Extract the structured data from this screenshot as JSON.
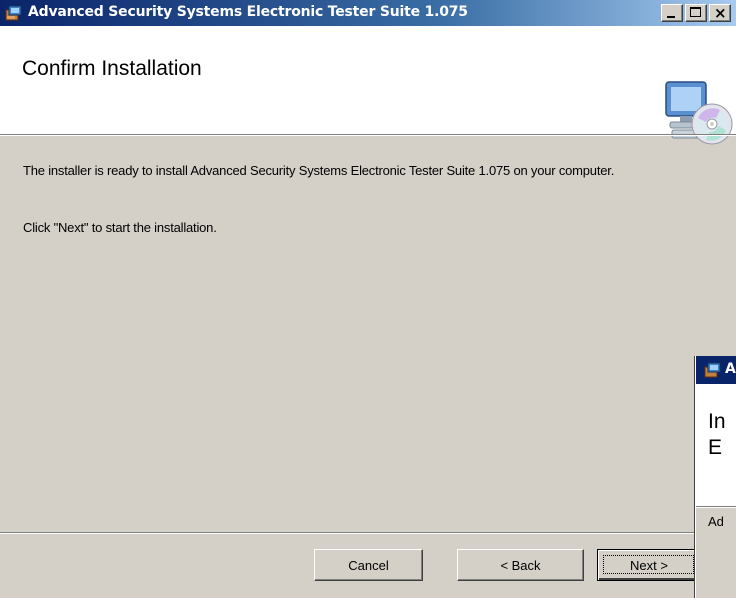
{
  "window": {
    "title": "Advanced Security Systems Electronic Tester Suite 1.075",
    "controls": {
      "minimize_icon": "minimize-icon",
      "maximize_icon": "maximize-icon",
      "close_icon": "close-icon"
    }
  },
  "banner": {
    "title": "Confirm Installation",
    "icon": "computer-cd-icon"
  },
  "body": {
    "line1": "The installer is ready to install Advanced Security Systems Electronic Tester Suite 1.075 on your computer.",
    "line2": "Click \"Next\" to start the installation."
  },
  "buttons": {
    "cancel": "Cancel",
    "back": "< Back",
    "next": "Next >"
  },
  "second_window": {
    "title": "Ad",
    "heading_line1": "In",
    "heading_line2": "E",
    "text": "Ad"
  },
  "colors": {
    "titlebar_active": "#0a246a",
    "face": "#d4d0c8",
    "banner_bg": "#ffffff"
  }
}
